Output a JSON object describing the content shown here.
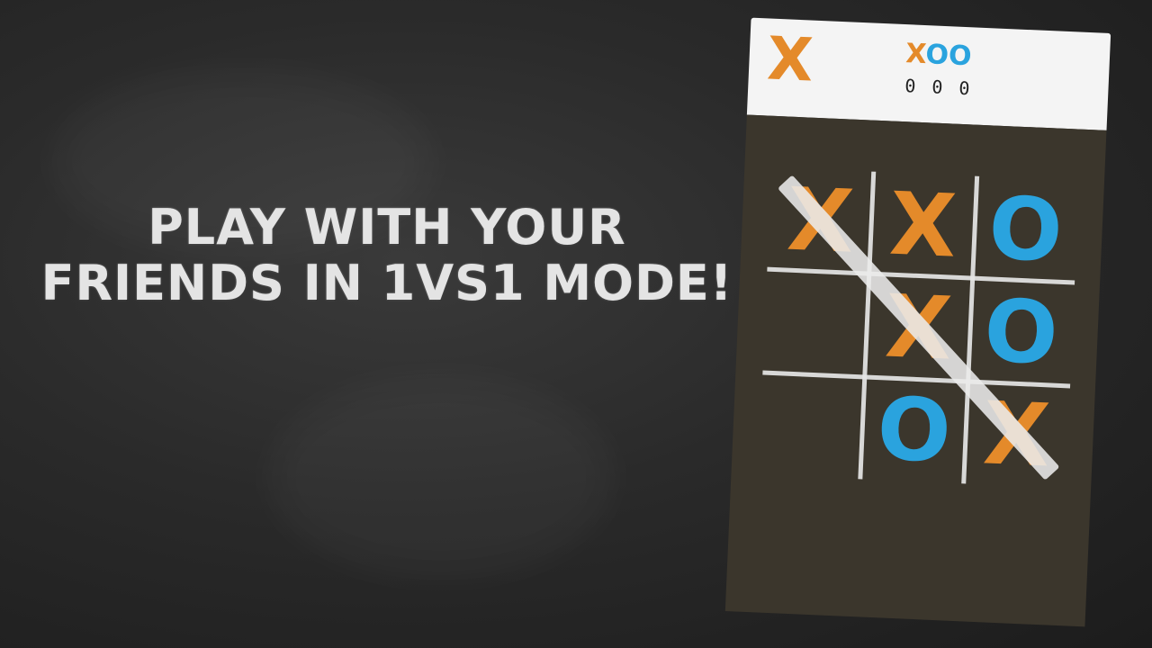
{
  "headline": {
    "line1": "PLAY WITH YOUR",
    "line2": "FRIENDS IN 1VS1 MODE!"
  },
  "game": {
    "turn_symbol": "X",
    "score": {
      "x_symbol": "X",
      "o_symbol": "O",
      "x_wins": "0",
      "draws": "0",
      "o_wins": "0"
    },
    "board": [
      "X",
      "X",
      "O",
      "",
      "X",
      "O",
      "",
      "O",
      "X"
    ],
    "winning_line": "diagonal top-left to bottom-right",
    "colors": {
      "x": "#e48a2a",
      "o": "#2aa3de",
      "background": "#2a2a2a",
      "board_background": "#3b362c"
    }
  }
}
